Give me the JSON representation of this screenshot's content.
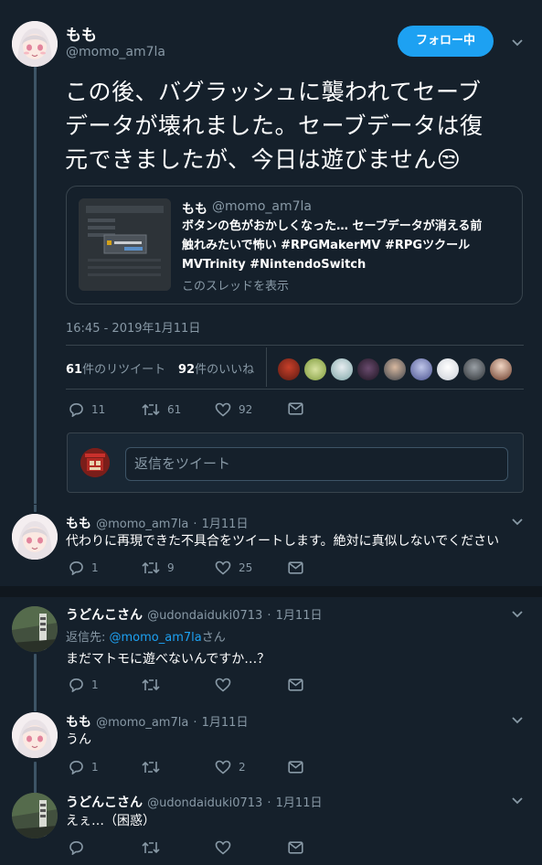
{
  "tweet": {
    "name": "もも",
    "handle": "@momo_am7la",
    "follow_label": "フォロー中",
    "text_line1": "この後、バグラッシュに襲われてセーブ",
    "text_line2": "データが壊れました。セーブデータは復",
    "text_line3": "元できましたが、今日は遊びません😒",
    "timestamp": "16:45 - 2019年1月11日",
    "retweets_num": "61",
    "retweets_label": "件のリツイート",
    "likes_num": "92",
    "likes_label": "件のいいね",
    "actions": {
      "reply": "11",
      "retweet": "61",
      "like": "92"
    }
  },
  "quote": {
    "name": "もも",
    "handle": "@momo_am7la",
    "text_line1": "ボタンの色がおかしくなった…  セーブデータが消える前",
    "text_line2": "触れみたいで怖い #RPGMakerMV #RPGツクール",
    "text_line3": "MVTrinity #NintendoSwitch",
    "thread_link": "このスレッドを表示"
  },
  "reply_box": {
    "placeholder": "返信をツイート"
  },
  "replies": [
    {
      "name": "もも",
      "handle": "@momo_am7la",
      "date": "1月11日",
      "text": "代わりに再現できた不具合をツイートします。絶対に真似しないでください",
      "reply": "1",
      "retweet": "9",
      "like": "25"
    },
    {
      "name": "うどんこさん",
      "handle": "@udondaiduki0713",
      "date": "1月11日",
      "reply_to_prefix": "返信先: ",
      "reply_to_handle": "@momo_am7la",
      "reply_to_suffix": "さん",
      "text": "まだマトモに遊べないんですか…？",
      "reply": "1",
      "retweet": "",
      "like": ""
    },
    {
      "name": "もも",
      "handle": "@momo_am7la",
      "date": "1月11日",
      "text": "うん",
      "reply": "1",
      "retweet": "",
      "like": "2"
    },
    {
      "name": "うどんこさん",
      "handle": "@udondaiduki0713",
      "date": "1月11日",
      "text": "えぇ…（困惑）",
      "reply": "",
      "retweet": "",
      "like": ""
    }
  ],
  "colors": {
    "background": "#15202b",
    "accent": "#1da1f2",
    "muted": "#8899a6",
    "border": "#38444d"
  }
}
